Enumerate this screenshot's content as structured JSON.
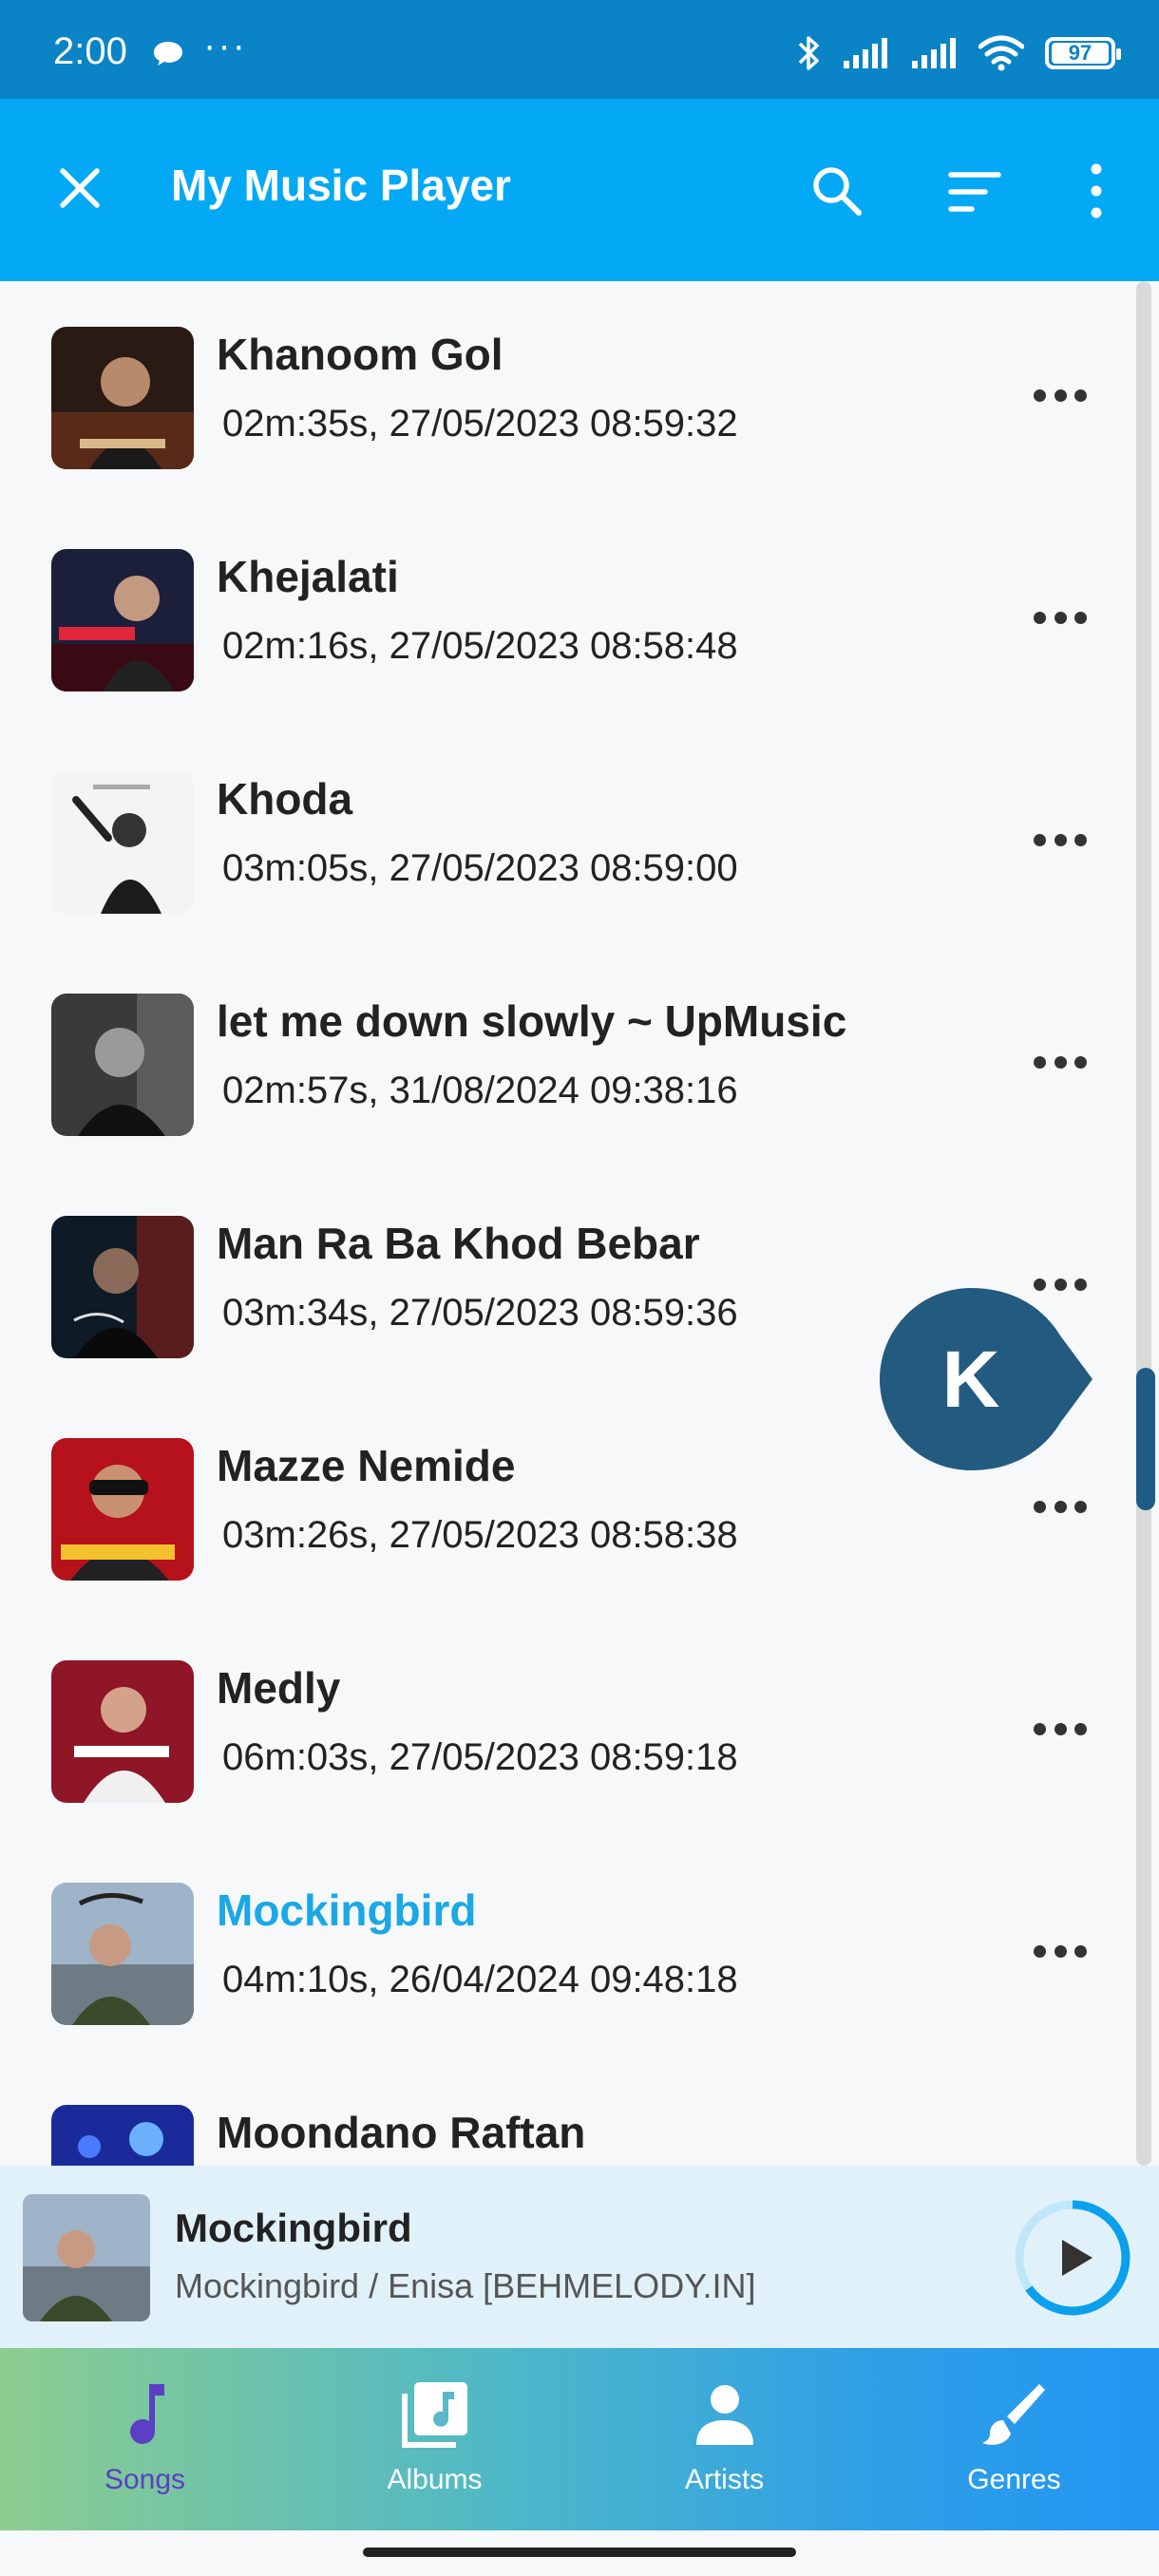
{
  "status_bar": {
    "time": "2:00",
    "more": "···",
    "battery": "97"
  },
  "app_bar": {
    "title": "My Music Player"
  },
  "songs": [
    {
      "title": "Khanoom Gol",
      "meta": "02m:35s, 27/05/2023 08:59:32",
      "active": false
    },
    {
      "title": "Khejalati",
      "meta": "02m:16s, 27/05/2023 08:58:48",
      "active": false
    },
    {
      "title": "Khoda",
      "meta": "03m:05s, 27/05/2023 08:59:00",
      "active": false
    },
    {
      "title": "let me down slowly  ~ UpMusic",
      "meta": "02m:57s, 31/08/2024 09:38:16",
      "active": false
    },
    {
      "title": "Man Ra Ba Khod Bebar",
      "meta": "03m:34s, 27/05/2023 08:59:36",
      "active": false
    },
    {
      "title": "Mazze Nemide",
      "meta": "03m:26s, 27/05/2023 08:58:38",
      "active": false
    },
    {
      "title": "Medly",
      "meta": "06m:03s, 27/05/2023 08:59:18",
      "active": false
    },
    {
      "title": "Mockingbird",
      "meta": "04m:10s, 26/04/2024 09:48:18",
      "active": true
    },
    {
      "title": "Moondano Raftan",
      "meta": "",
      "active": false
    }
  ],
  "fast_scroll": {
    "letter": "K"
  },
  "now_playing": {
    "title": "Mockingbird",
    "subtitle": "Mockingbird / Enisa [BEHMELODY.IN]"
  },
  "bottom_nav": [
    {
      "label": "Songs",
      "icon": "music-note-icon",
      "active": true
    },
    {
      "label": "Albums",
      "icon": "album-icon",
      "active": false
    },
    {
      "label": "Artists",
      "icon": "person-icon",
      "active": false
    },
    {
      "label": "Genres",
      "icon": "brush-icon",
      "active": false
    }
  ],
  "colors": {
    "status_bar": "#0a84c6",
    "app_bar": "#03a9f4",
    "active_song": "#1aa8e6",
    "fast_scroll_bubble": "#235b80",
    "mini_player_bg": "#e1f1fa",
    "active_nav": "#5b3fc4"
  }
}
